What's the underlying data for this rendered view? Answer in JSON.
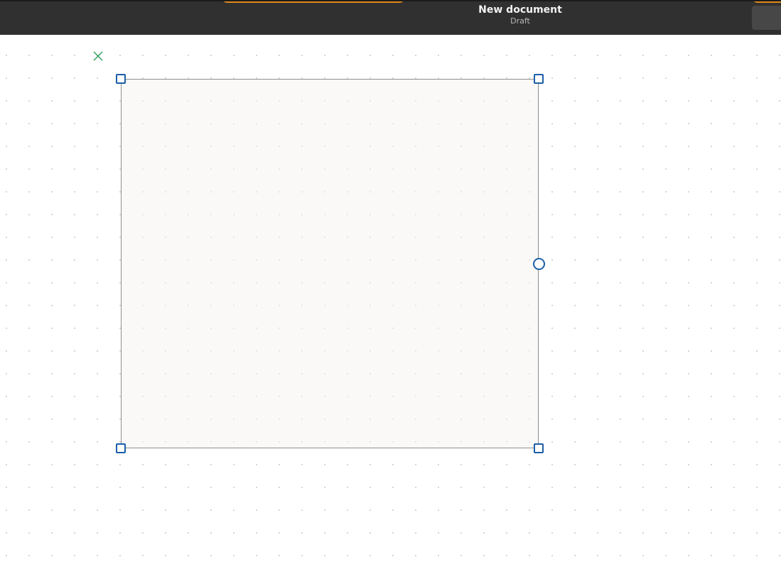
{
  "header": {
    "title": "New document",
    "subtitle": "Draft"
  },
  "icons": {
    "cancel": "close-icon",
    "rotate_handle": "circle-handle",
    "resize_handle": "square-handle"
  },
  "colors": {
    "header_bg": "#303030",
    "accent": "#e08a1a",
    "selection": "#1c5ea8",
    "cancel": "#2e9e5a",
    "shape_border": "#8f8f8f",
    "shape_fill": "#f7f6f3"
  }
}
